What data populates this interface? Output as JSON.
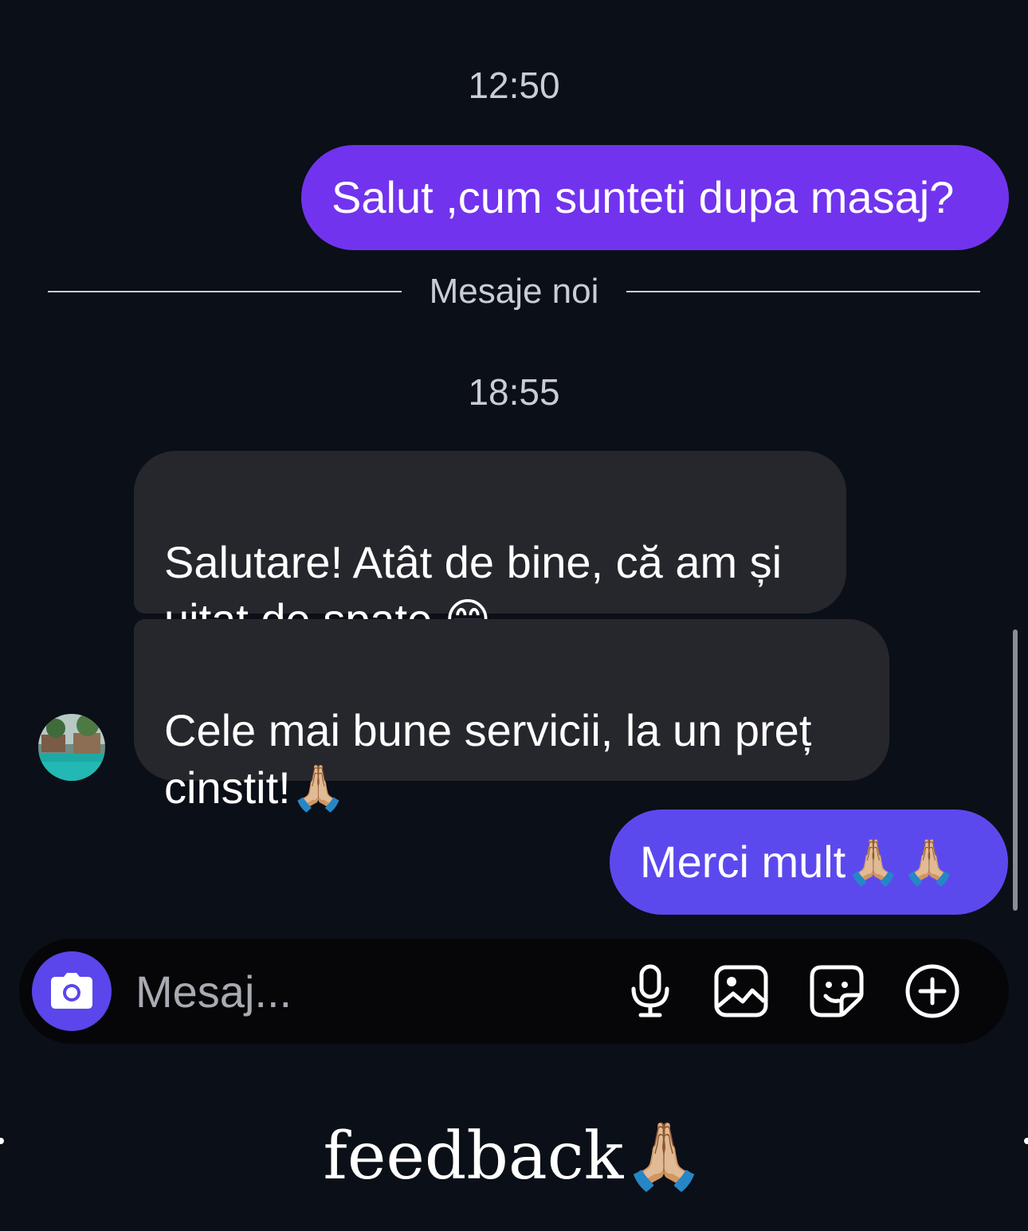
{
  "conversation": {
    "timestamps": [
      "12:50",
      "18:55"
    ],
    "new_messages_label": "Mesaje noi",
    "messages": [
      {
        "direction": "sent",
        "text": "Salut ,cum sunteti dupa masaj?"
      },
      {
        "direction": "received",
        "text": "Salutare! Atât de bine, că am și\nuitat de spate 😁"
      },
      {
        "direction": "received",
        "text": "Cele mai bune servicii,  la un preț\ncinstit!🙏🏼"
      },
      {
        "direction": "sent",
        "text": "Merci mult🙏🏼🙏🏼"
      }
    ]
  },
  "composer": {
    "placeholder": "Mesaj...",
    "icons": [
      "camera-icon",
      "microphone-icon",
      "gallery-icon",
      "sticker-icon",
      "plus-circle-icon"
    ]
  },
  "caption": "feedback🙏🏼",
  "colors": {
    "background": "#0b0f17",
    "sent_bubble": "#7233ee",
    "sent_bubble_alt": "#5c49ee",
    "received_bubble": "#26272d",
    "camera_button": "#5a46ea"
  }
}
